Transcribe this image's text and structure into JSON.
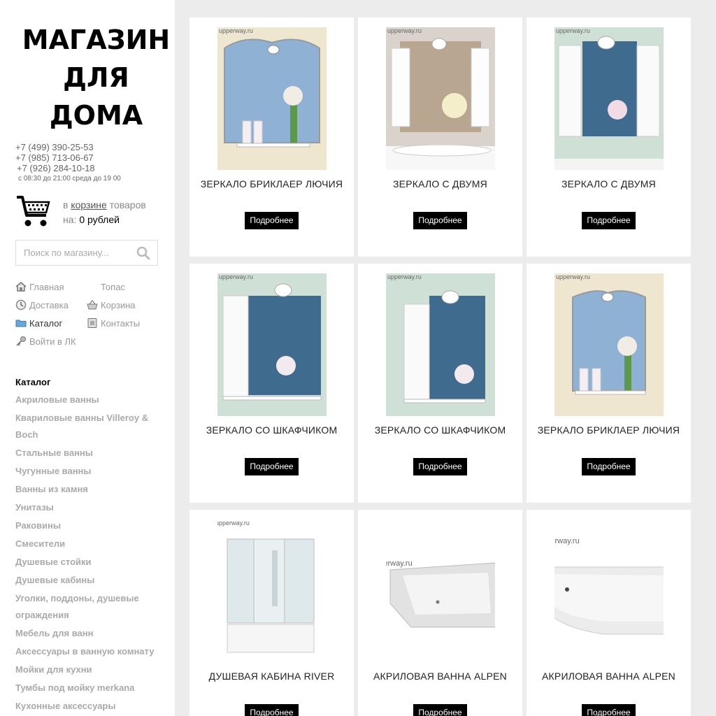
{
  "logo": {
    "line1": "МАГАЗИН",
    "line2": "ДЛЯ",
    "line3": "ДОМА"
  },
  "contacts": {
    "phone1": "+7 (499) 390-25-53",
    "phone2": "+7 (985) 713-06-67",
    "phone3": "+7 (926) 284-10-18",
    "hours": "с 08:30 до 21:00 среда до 19 00"
  },
  "cart": {
    "prefix": "в",
    "link": "корзине",
    "suffix": "товаров",
    "sum_label": "на:",
    "sum": "0 рублей"
  },
  "search": {
    "placeholder": "Поиск по магазину..."
  },
  "nav": {
    "home": "Главная",
    "topas": "Топас",
    "delivery": "Доставка",
    "cart": "Корзина",
    "catalog": "Каталог",
    "contacts": "Контакты",
    "login": "Войти в ЛК"
  },
  "catalog": {
    "title": "Каталог",
    "items": [
      "Акриловые ванны",
      "Квариловые ванны Villeroy &",
      "Boch",
      "Стальные ванны",
      "Чугунные ванны",
      "Ванны из камня",
      "Унитазы",
      "Раковины",
      "Смесители",
      "Душевые стойки",
      "Душевые кабины",
      "Уголки, поддоны, душевые",
      "ограждения",
      "Мебель для ванн",
      "Аксессуары в ванную комнату",
      "Мойки для кухни",
      "Тумбы под мойку merkana",
      "Кухонные аксессуары"
    ]
  },
  "products": [
    {
      "title": "ЗЕРКАЛО БРИКЛАЕР ЛЮЧИЯ",
      "button": "Подробнее",
      "watermark": "upperway.ru"
    },
    {
      "title": "ЗЕРКАЛО С ДВУМЯ",
      "button": "Подробнее",
      "watermark": "upperway.ru"
    },
    {
      "title": "ЗЕРКАЛО С ДВУМЯ",
      "button": "Подробнее",
      "watermark": "upperway.ru"
    },
    {
      "title": "ЗЕРКАЛО СО ШКАФЧИКОМ",
      "button": "Подробнее",
      "watermark": "upperway.ru"
    },
    {
      "title": "ЗЕРКАЛО СО ШКАФЧИКОМ",
      "button": "Подробнее",
      "watermark": "upperway.ru"
    },
    {
      "title": "ЗЕРКАЛО БРИКЛАЕР ЛЮЧИЯ",
      "button": "Подробнее",
      "watermark": "upperway.ru"
    },
    {
      "title": "ДУШЕВАЯ КАБИНА RIVER",
      "button": "Подробнее",
      "watermark": "upperway.ru"
    },
    {
      "title": "АКРИЛОВАЯ ВАННА ALPEN",
      "button": "Подробнее",
      "watermark": "upperway.ru"
    },
    {
      "title": "АКРИЛОВАЯ ВАННА ALPEN",
      "button": "Подробнее",
      "watermark": "upperway.ru"
    }
  ],
  "colors": {
    "button_bg": "#000000",
    "page_bg": "#ececec",
    "muted_text": "#aaaaaa"
  }
}
